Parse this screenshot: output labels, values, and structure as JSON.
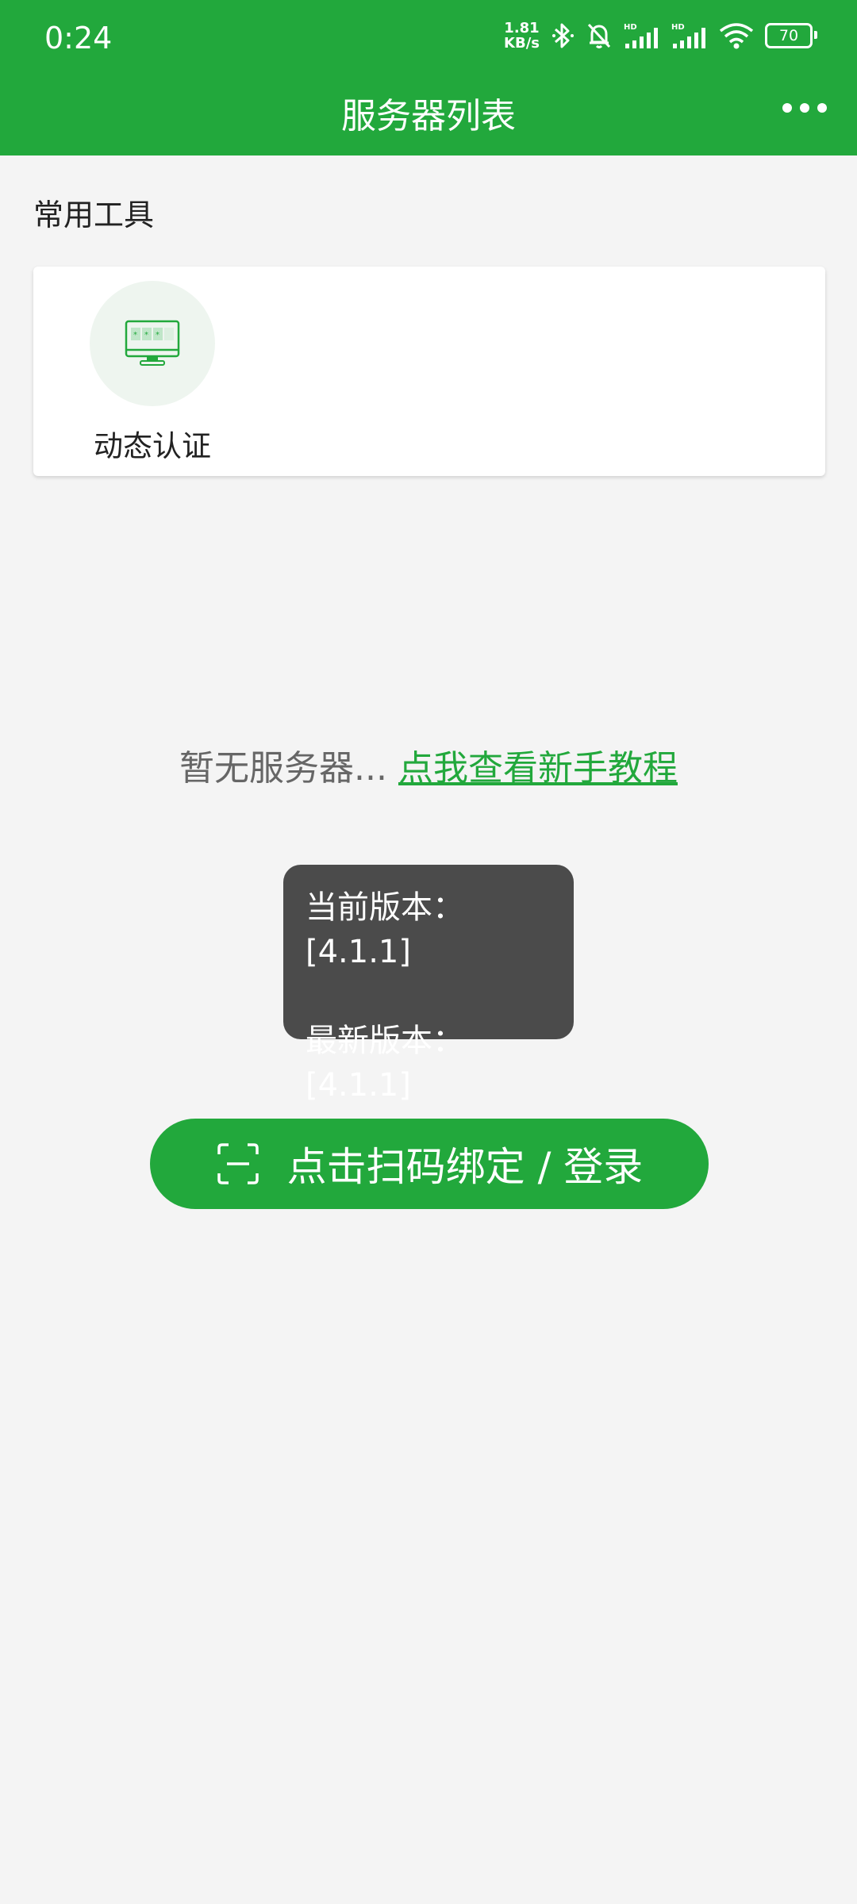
{
  "status_bar": {
    "time": "0:24",
    "net_speed_value": "1.81",
    "net_speed_unit": "KB/s",
    "battery": "70",
    "icons": [
      "bluetooth-icon",
      "bell-off-icon",
      "signal-hd-icon",
      "signal-hd-icon",
      "wifi-icon",
      "battery-icon"
    ]
  },
  "app_bar": {
    "title": "服务器列表",
    "more_icon": "more-dots-icon"
  },
  "tools": {
    "section_title": "常用工具",
    "items": [
      {
        "label": "动态认证",
        "icon": "monitor-auth-icon"
      }
    ]
  },
  "empty_state": {
    "message": "暂无服务器...",
    "link": "点我查看新手教程"
  },
  "version_toast": {
    "current": "当前版本：[4.1.1]",
    "latest": "最新版本：[4.1.1]"
  },
  "scan_button": {
    "label": "点击扫码绑定 / 登录",
    "icon": "scan-icon"
  },
  "colors": {
    "brand": "#22a83c",
    "background": "#f4f4f4",
    "toast_bg": "#4b4b4b"
  }
}
